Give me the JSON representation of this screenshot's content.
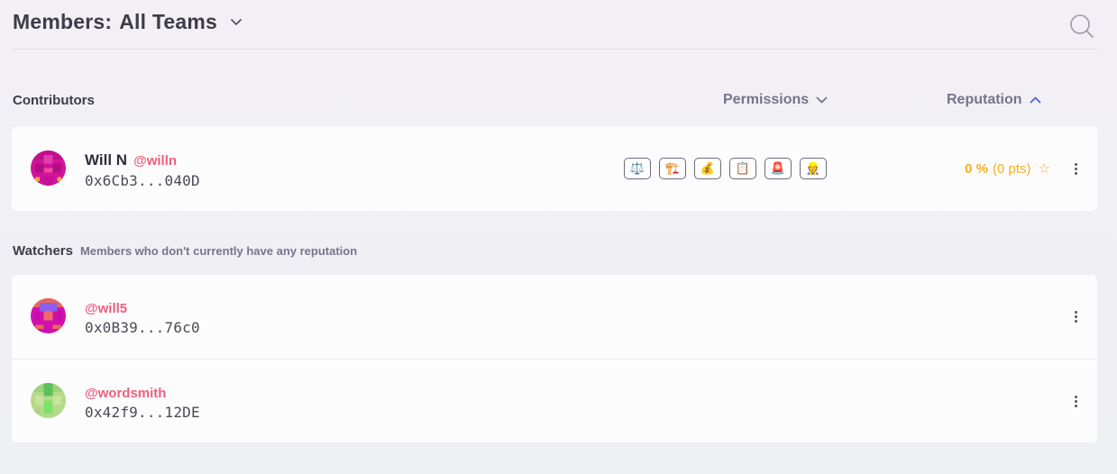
{
  "header": {
    "title_prefix": "Members:",
    "title_team": "All Teams"
  },
  "contributors": {
    "label": "Contributors",
    "permissions_header": "Permissions",
    "reputation_header": "Reputation",
    "members": [
      {
        "name": "Will N",
        "handle": "@willn",
        "address": "0x6Cb3...040D",
        "permissions": [
          {
            "icon": "⚖️",
            "name": "arbitration"
          },
          {
            "icon": "🏗️",
            "name": "architecture"
          },
          {
            "icon": "💰",
            "name": "funding"
          },
          {
            "icon": "📋",
            "name": "administration"
          },
          {
            "icon": "🚨",
            "name": "recovery"
          },
          {
            "icon": "👷",
            "name": "root"
          }
        ],
        "reputation_percent": "0 %",
        "reputation_points": "(0 pts)",
        "star": "☆"
      }
    ]
  },
  "watchers": {
    "label": "Watchers",
    "note": "Members who don't currently have any reputation",
    "members": [
      {
        "handle": "@will5",
        "address": "0x0B39...76c0"
      },
      {
        "handle": "@wordsmith",
        "address": "0x42f9...12DE"
      }
    ]
  },
  "colors": {
    "handle": "#ec6080",
    "reputation": "#f5b01b",
    "accent_chevron": "#4b63d6"
  }
}
